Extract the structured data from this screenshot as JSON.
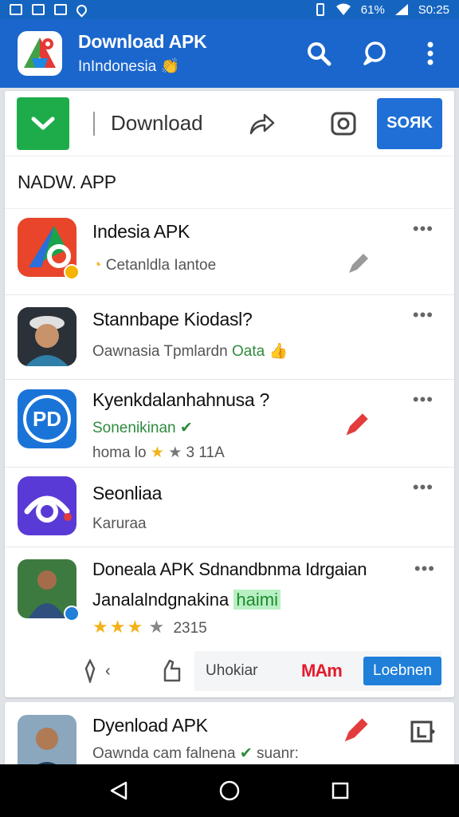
{
  "status_bar": {
    "battery": "61%",
    "time": "S0:25"
  },
  "app_bar": {
    "title": "Download APK",
    "subtitle": "InIndonesia",
    "subtitle_emoji": "👏",
    "icons": [
      "search-icon",
      "chat-icon",
      "more-vert-icon"
    ]
  },
  "toolbar": {
    "download_label": "Download",
    "search_label": "SOЯK"
  },
  "section": {
    "heading": "NADW. APP"
  },
  "apps": [
    {
      "title": "Indesia APK",
      "subtitle": "Cetanldla Iantoe",
      "icon_color": "#e8452a"
    },
    {
      "title": "Stannbape Kiodasl?",
      "subtitle": "Oawnasia Tpmlardn",
      "subtitle_tag": "Oata",
      "icon_color": "#2a3138"
    },
    {
      "title": "Kyenkdalanhahnusa ?",
      "subtitle": "Sonenikinan",
      "meta": "homa lo",
      "meta_count": "3 11A",
      "icon_color": "#1a74d8",
      "icon_text": "PD"
    },
    {
      "title": "Seonliaa",
      "subtitle": "Karuraa",
      "icon_color": "#5a3ad6"
    },
    {
      "title": "Doneala APK Sdnandbnma Idrgaian",
      "subtitle": "Janalalndgnakina",
      "subtitle_highlight": "haimi",
      "rating_stars": "★★★",
      "rating_half": "★",
      "rating_count": "2315",
      "action_pill_text": "Uhokiar",
      "action_brand": "MAm",
      "action_open": "Loebnen",
      "icon_color": "#3d7a3f"
    }
  ],
  "bottom_item": {
    "title": "Dyenload APK",
    "subtitle": "Oawnda cam falnena",
    "subtitle_end": "suanr:",
    "icon_color": "#5d7f9a"
  },
  "colors": {
    "brand_blue": "#1a66cc",
    "download_green": "#1eac4a",
    "star_yellow": "#f2b21a"
  }
}
